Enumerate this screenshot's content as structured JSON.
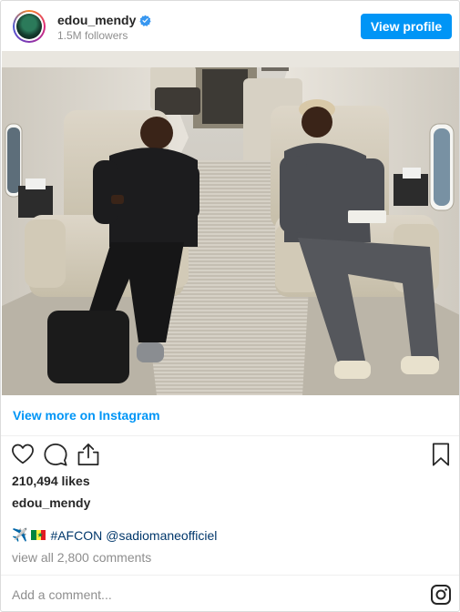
{
  "header": {
    "username": "edou_mendy",
    "verified_icon": "verified-badge-icon",
    "followers": "1.5M followers",
    "view_profile_label": "View profile"
  },
  "post": {
    "image_alt": "Two men sitting in beige leather seats inside a private jet cabin"
  },
  "links": {
    "view_more": "View more on Instagram"
  },
  "actions": {
    "icons": [
      "heart-icon",
      "comment-icon",
      "share-icon",
      "bookmark-icon"
    ]
  },
  "stats": {
    "likes": "210,494 likes",
    "author": "edou_mendy"
  },
  "caption": {
    "airplane_emoji": "✈️",
    "flag": "Senegal flag",
    "hashtag": "#AFCON",
    "mention": "@sadiomaneofficiel"
  },
  "comments": {
    "view_all": "view all 2,800 comments",
    "placeholder": "Add a comment..."
  },
  "colors": {
    "accent": "#0095f6",
    "link_dark": "#00376b",
    "muted": "#8e8e8e"
  }
}
